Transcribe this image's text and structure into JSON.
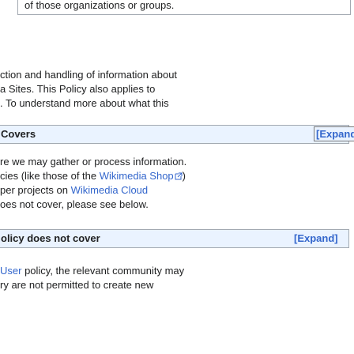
{
  "top_box": {
    "text": "of those organizations or groups."
  },
  "intro_lines": [
    "ction and handling of information about",
    "a Sites. This Policy also applies to",
    ". To understand more about what this"
  ],
  "section1": {
    "title": "Covers",
    "expand_label": "[Expand]",
    "lines": [
      {
        "pre": "re we may gather or process information.",
        "link": "",
        "post": ""
      },
      {
        "pre": "cies (like those of the ",
        "link": "Wikimedia Shop",
        "post": ")"
      },
      {
        "pre": "per projects on ",
        "link": "Wikimedia Cloud",
        "post": ""
      },
      {
        "pre": "oes not cover, please see below.",
        "link": "",
        "post": ""
      }
    ]
  },
  "section2": {
    "title": "olicy does not cover",
    "expand_label": "[Expand]",
    "lines": [
      {
        "pre": "",
        "link": "User",
        "post": " policy, the relevant community may"
      },
      {
        "pre": "ry are not permitted to create new",
        "link": "",
        "post": ""
      }
    ]
  },
  "colors": {
    "link": "#3366cc",
    "header_bg": "#eaf3ff",
    "border": "#a2a9b1"
  },
  "icons": {
    "external_link": "external-link-icon"
  }
}
